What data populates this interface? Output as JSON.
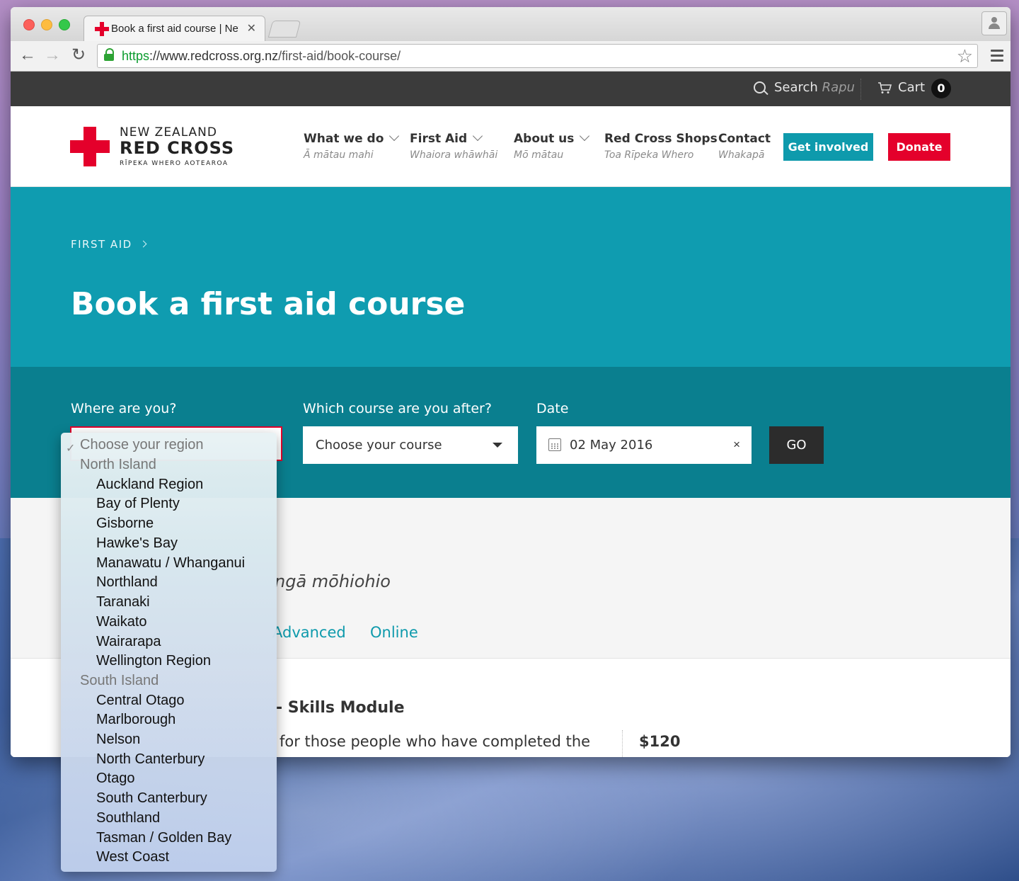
{
  "browser": {
    "tab_title": "Book a first aid course | New Zealand Red Cross",
    "url_scheme": "https",
    "url_sep": "://",
    "url_host": "www.redcross.org.nz",
    "url_path": "/first-aid/book-course/"
  },
  "util": {
    "search_label": "Search",
    "search_maori": "Rapu",
    "cart_label": "Cart",
    "cart_count": "0"
  },
  "logo": {
    "line1": "NEW ZEALAND",
    "line2": "RED CROSS",
    "line3": "RĪPEKA WHERO AOTEAROA"
  },
  "nav": [
    {
      "label": "What we do",
      "sub": "Ā mātau mahi"
    },
    {
      "label": "First Aid",
      "sub": "Whaiora whāwhāi"
    },
    {
      "label": "About us",
      "sub": "Mō mātau"
    },
    {
      "label": "Red Cross Shops",
      "sub": "Toa Rīpeka Whero"
    },
    {
      "label": "Contact",
      "sub": "Whakapā"
    }
  ],
  "buttons": {
    "get_involved": "Get involved",
    "donate": "Donate",
    "go": "GO"
  },
  "hero": {
    "breadcrumb": "FIRST AID",
    "title": "Book a first aid course"
  },
  "filters": {
    "region_label": "Where are you?",
    "course_label": "Which course are you after?",
    "date_label": "Date",
    "course_value": "Choose your course",
    "date_value": "02 May 2016",
    "clear": "×"
  },
  "region_dropdown": {
    "selected": "Choose your region",
    "groups": [
      {
        "name": "North Island",
        "options": [
          "Auckland Region",
          "Bay of Plenty",
          "Gisborne",
          "Hawke's Bay",
          "Manawatu / Whanganui",
          "Northland",
          "Taranaki",
          "Waikato",
          "Wairarapa",
          "Wellington Region"
        ]
      },
      {
        "name": "South Island",
        "options": [
          "Central Otago",
          "Marlborough",
          "Nelson",
          "North Canterbury",
          "Otago",
          "South Canterbury",
          "Southland",
          "Tasman / Golden Bay",
          "West Coast"
        ]
      }
    ]
  },
  "content": {
    "subtitle_fragment": "ngā mōhiohio",
    "tab_advanced": "Advanced",
    "tab_online": "Online",
    "course_title_fragment": "- Skills Module",
    "course_desc_fragment": "for those people who have completed the",
    "price": "$120"
  }
}
